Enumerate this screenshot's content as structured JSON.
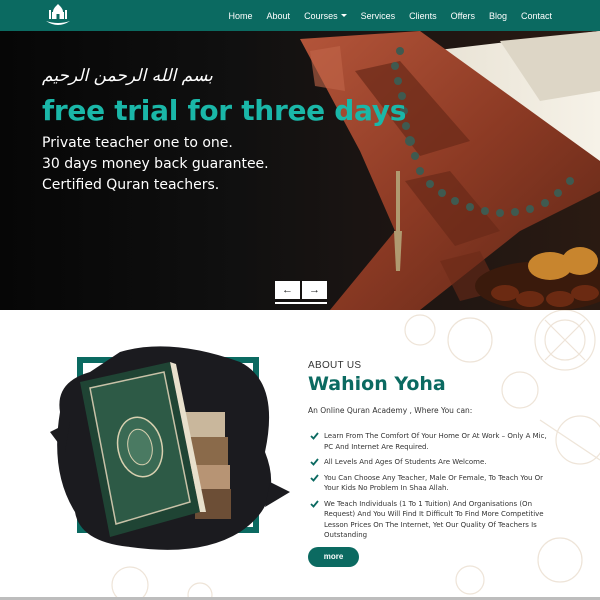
{
  "nav": {
    "items": [
      {
        "label": "Home"
      },
      {
        "label": "About"
      },
      {
        "label": "Courses"
      },
      {
        "label": "Services"
      },
      {
        "label": "Clients"
      },
      {
        "label": "Offers"
      },
      {
        "label": "Blog"
      },
      {
        "label": "Contact"
      }
    ],
    "logo_icon": "mosque-logo-icon",
    "dropdown_icon": "caret-down-icon"
  },
  "hero": {
    "bismillah": "بسم الله الرحمن الرحيم",
    "title": "free trial for three days",
    "lines": [
      "Private teacher one to one.",
      "30 days money back guarantee.",
      "Certified Quran teachers."
    ],
    "prev_label": "←",
    "next_label": "→"
  },
  "about": {
    "label": "ABOUT US",
    "title": "Wahion Yoha",
    "intro": "An Online Quran Academy , Where You can:",
    "features": [
      "Learn From The Comfort Of Your Home Or At Work – Only A Mic, PC And Internet Are Required.",
      "All Levels And Ages Of Students Are Welcome.",
      "You Can Choose Any Teacher, Male Or Female, To Teach You Or Your Kids No Problem In Shaa Allah.",
      "We Teach Individuals (1 To 1 Tuition) And Organisations (On Request) And You Will Find It Difficult To Find More Competitive Lesson Prices On The Internet, Yet Our Quality Of Teachers Is Outstanding"
    ],
    "more_label": "more"
  },
  "colors": {
    "brand": "#0b6a61",
    "accent": "#1ab7a8",
    "text": "#333333"
  }
}
